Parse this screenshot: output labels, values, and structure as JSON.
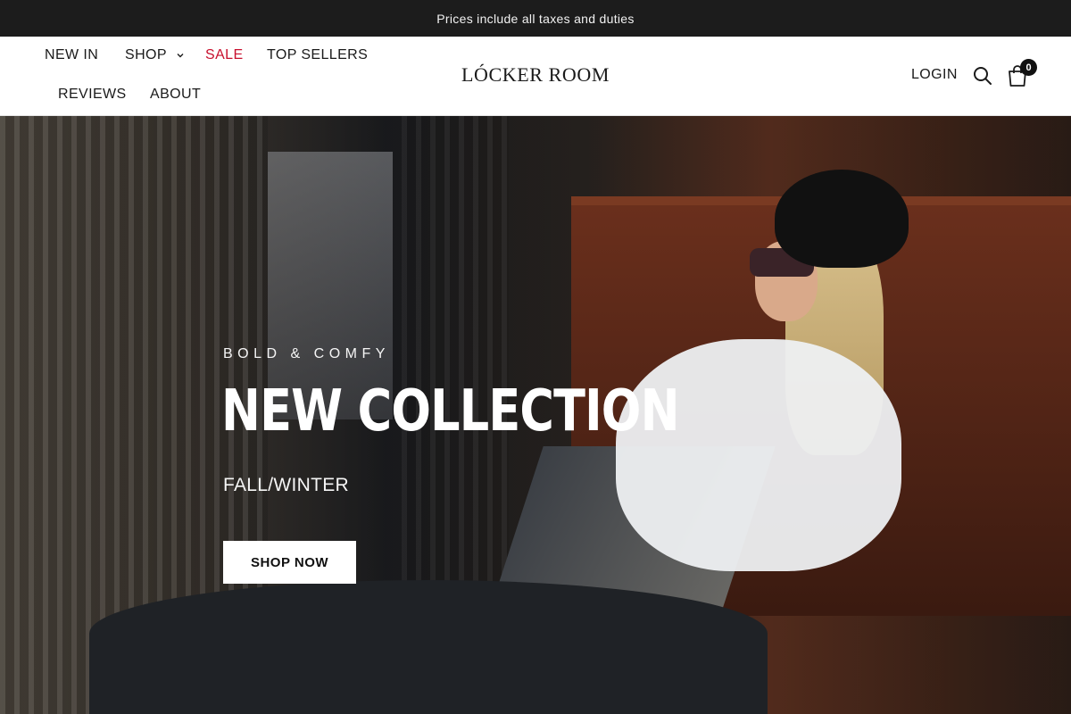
{
  "announcement": {
    "text": "Prices include all taxes and duties"
  },
  "header": {
    "nav": [
      {
        "label": "NEW IN"
      },
      {
        "label": "SHOP"
      },
      {
        "label": "SALE"
      },
      {
        "label": "TOP SELLERS"
      },
      {
        "label": "REVIEWS"
      },
      {
        "label": "ABOUT"
      }
    ],
    "logo": "LÓCKER ROOM",
    "login": "LOGIN",
    "cart_count": "0"
  },
  "hero": {
    "eyebrow": "BOLD & COMFY",
    "title": "NEW COLLECTION",
    "subtitle": "FALL/WINTER",
    "cta": "SHOP NOW"
  },
  "colors": {
    "sale": "#c8102e",
    "announcement_bg": "#1c1c1c",
    "cta_bg": "#ffffff"
  },
  "icons": [
    "chevron-down-icon",
    "search-icon",
    "shopping-bag-icon"
  ]
}
